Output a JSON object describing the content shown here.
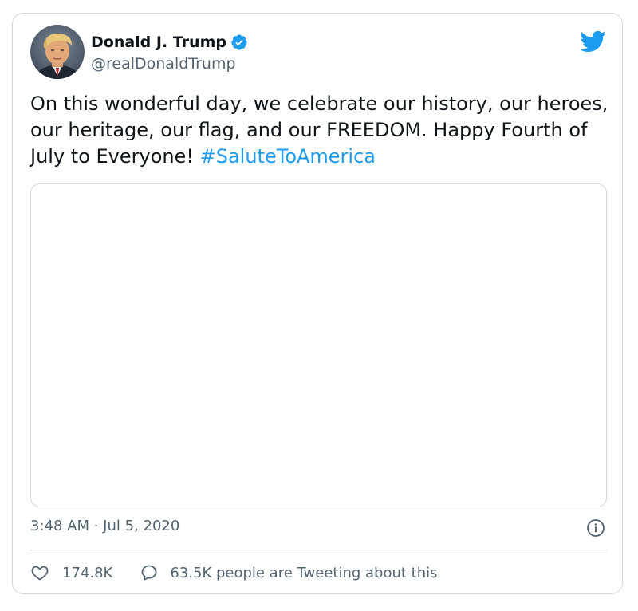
{
  "author": {
    "display_name": "Donald J. Trump",
    "handle": "@realDonaldTrump",
    "verified": true
  },
  "tweet": {
    "text": "On this wonderful day, we celebrate our history, our heroes, our heritage, our flag, and our FREEDOM. Happy Fourth of July to Everyone! ",
    "hashtag": "#SaluteToAmerica",
    "timestamp": "3:48 AM · Jul 5, 2020"
  },
  "engagement": {
    "likes": "174.8K",
    "conversation_text": "63.5K people are Tweeting about this"
  },
  "icons": {
    "brand": "twitter-bird-icon",
    "verified": "verified-badge-icon",
    "info": "info-icon",
    "like": "heart-icon",
    "reply": "speech-bubble-icon"
  },
  "colors": {
    "accent": "#1d9bf0",
    "text_primary": "#0f1419",
    "text_secondary": "#536471",
    "border": "#cfd9de"
  }
}
